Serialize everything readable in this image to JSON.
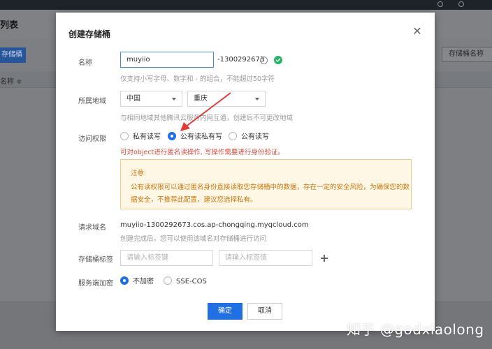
{
  "background": {
    "page_title": "列表",
    "create_button": "存储桶",
    "search_button": "存储桶名称",
    "column_name": "名称 ≑"
  },
  "modal": {
    "title": "创建存储桶",
    "name": {
      "label": "名称",
      "value": "muyiio",
      "suffix": "-1300292673",
      "hint": "仅支持小写字母、数字和 - 的组合，不能超过50字符"
    },
    "region": {
      "label": "所属地域",
      "country": "中国",
      "city": "重庆",
      "hint": "与相同地域其他腾讯云服务内网互通，创建后不可更改地域"
    },
    "access": {
      "label": "访问权限",
      "options": [
        "私有读写",
        "公有读私有写",
        "公有读写"
      ],
      "selected": "公有读私有写",
      "warning": "可对object进行匿名读操作, 写操作需要进行身份验证。"
    },
    "notice": {
      "title": "注意:",
      "line1": "公有读权限可以通过匿名身份直接读取您存储桶中的数据，存在一定的安全风险，为确保您的数",
      "line2": "据安全，不推荐此配置，建议您选择私有。"
    },
    "domain": {
      "label": "请求域名",
      "value": "muyiio-1300292673.cos.ap-chongqing.myqcloud.com",
      "hint": "创建完成后，您可以使用该域名对存储桶进行访问"
    },
    "tags": {
      "label": "存储桶标签",
      "key_placeholder": "请输入标签键",
      "value_placeholder": "请输入标签值"
    },
    "encryption": {
      "label": "服务端加密",
      "options": [
        "不加密",
        "SSE-COS"
      ],
      "selected": "不加密"
    },
    "buttons": {
      "confirm": "确定",
      "cancel": "取消"
    }
  },
  "watermark": "知乎 @godxiaolong",
  "colors": {
    "primary": "#1f6fe5",
    "warning": "#d84a3c",
    "notice_text": "#c8770c",
    "notice_bg": "#fff7e6",
    "annotation_arrow": "#e53935"
  }
}
